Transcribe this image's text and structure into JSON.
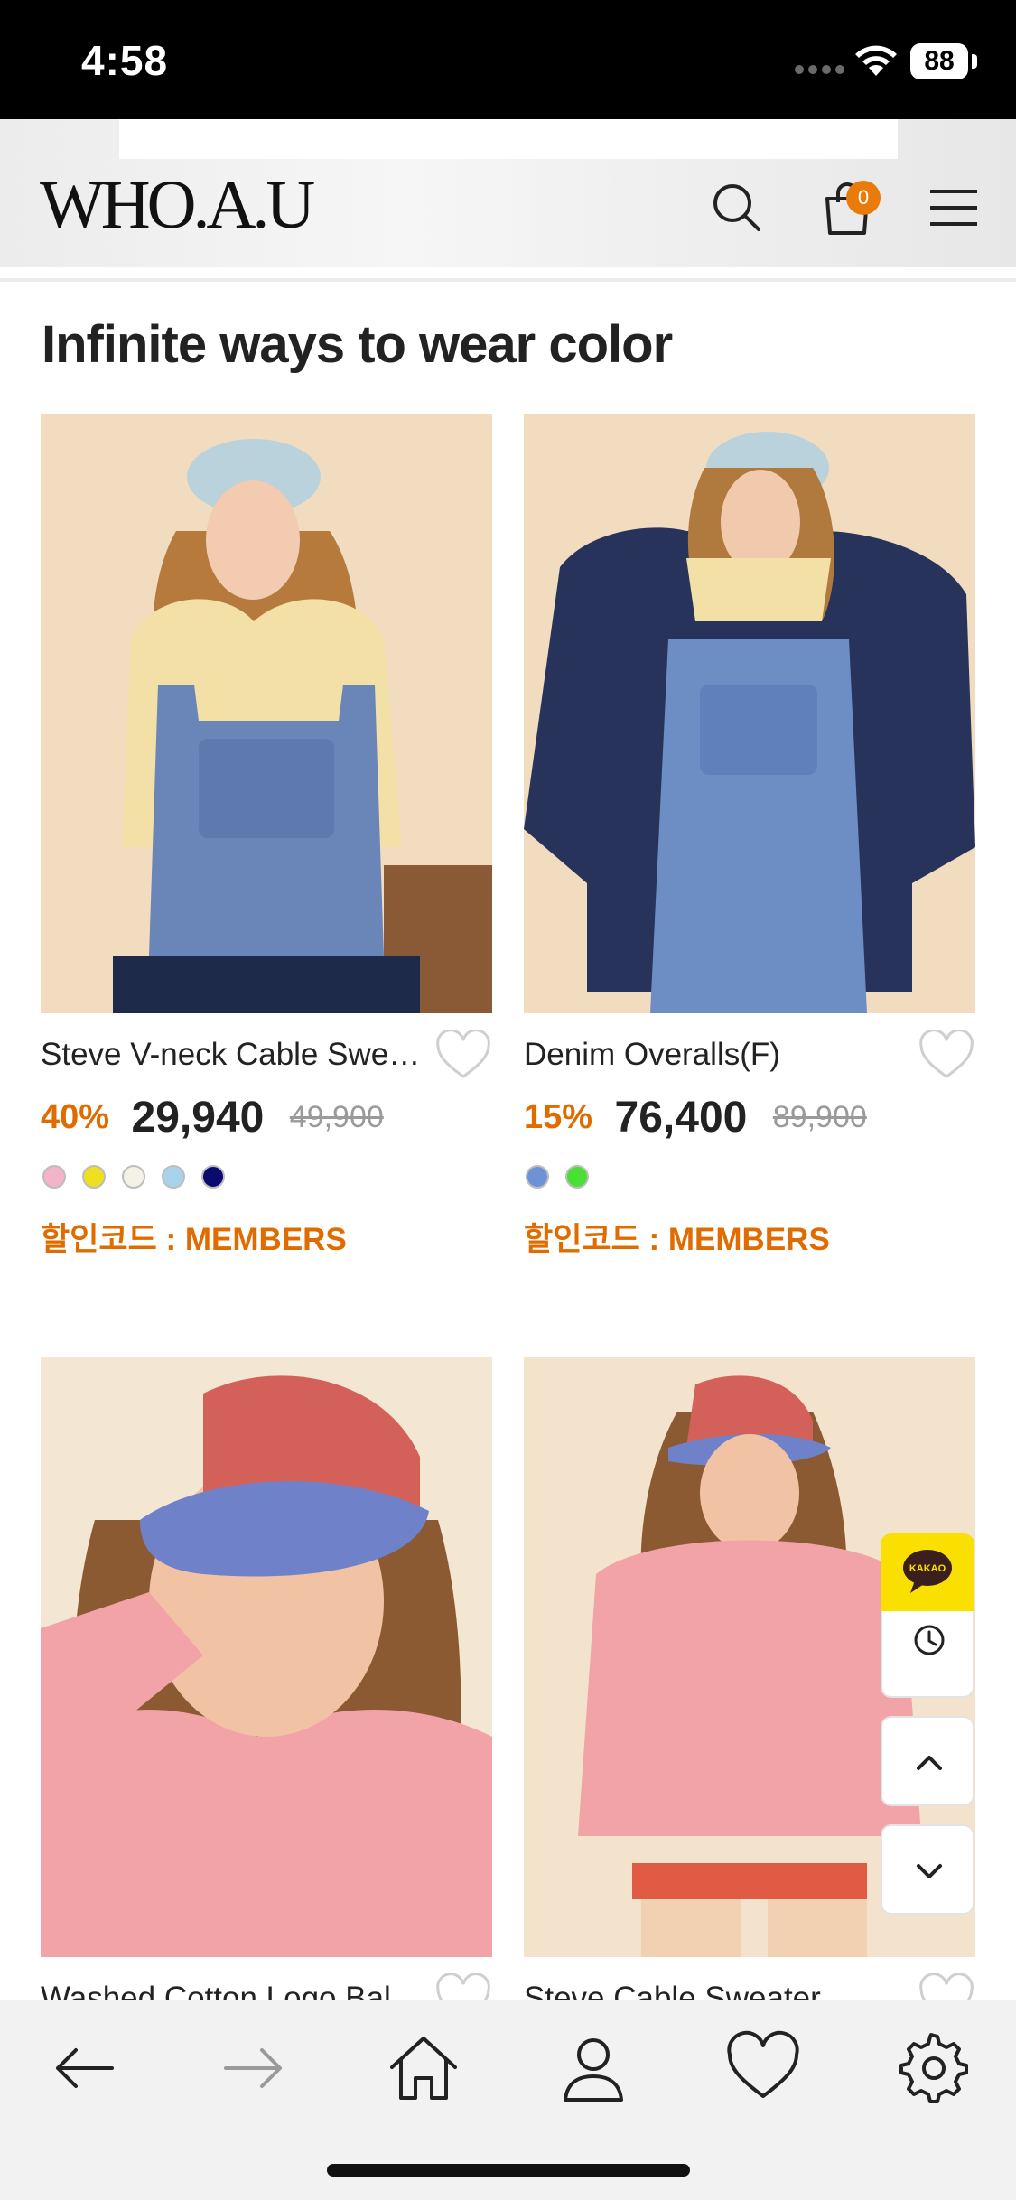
{
  "status_bar": {
    "time": "4:58",
    "battery": "88"
  },
  "header": {
    "logo": "WHO.A.U",
    "cart_count": "0"
  },
  "section": {
    "title": "Infinite ways to wear color"
  },
  "products": [
    {
      "name": "Steve V-neck Cable Swe…",
      "discount": "40%",
      "price": "29,940",
      "original_price": "49,900",
      "colors": [
        "#f3b3c9",
        "#eee021",
        "#f4f2e4",
        "#a9d3ea",
        "#0b0b6e"
      ],
      "promo": "할인코드 : MEMBERS"
    },
    {
      "name": "Denim Overalls(F)",
      "discount": "15%",
      "price": "76,400",
      "original_price": "89,900",
      "colors": [
        "#6d93d6",
        "#49e036"
      ],
      "promo": "할인코드 : MEMBERS"
    },
    {
      "name": "Washed Cotton Logo Ball Cap"
    },
    {
      "name": "Steve Cable Sweater"
    }
  ],
  "floating": {
    "kakao_label": "KAKAO"
  },
  "colors": {
    "accent": "#e06c00",
    "kakao": "#f9e000"
  }
}
